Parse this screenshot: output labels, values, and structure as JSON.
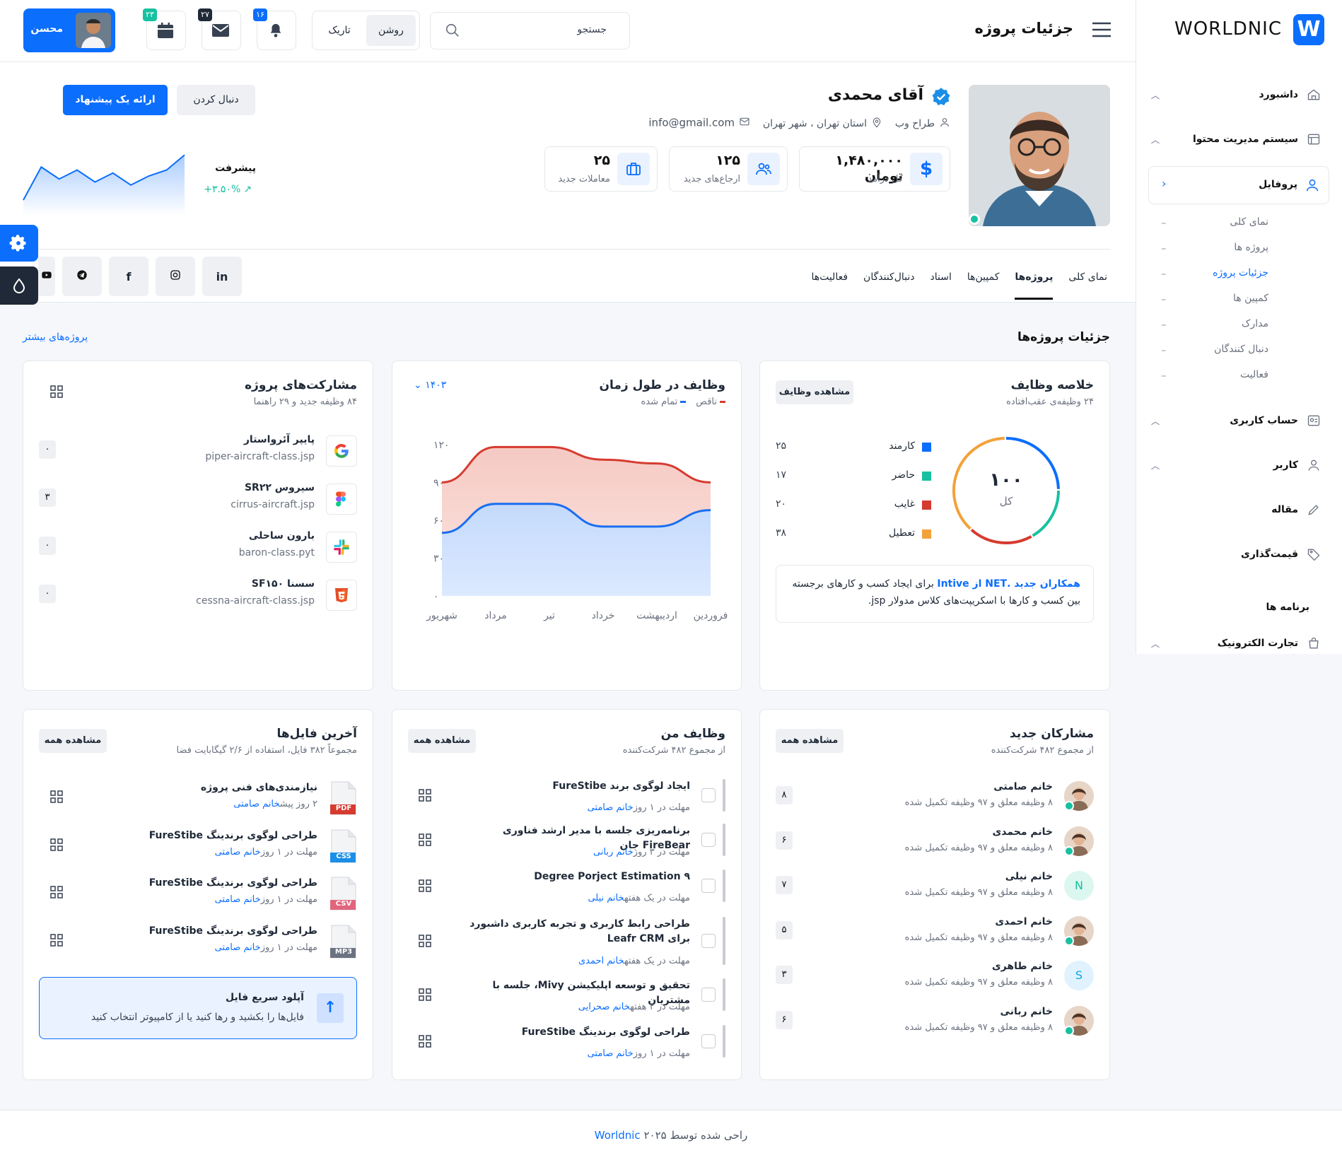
{
  "brand": {
    "name": "WORLDNIC",
    "logo_letter": "W"
  },
  "header": {
    "title": "جزئیات پروژه",
    "search_placeholder": "جستجو",
    "theme_light": "روشن",
    "theme_dark": "تاریک",
    "notif_count": "۱۶",
    "mail_count": "۲۷",
    "calendar_count": "۲۳",
    "user_name": "محسن"
  },
  "sidebar": {
    "items": [
      {
        "label": "داشبورد",
        "icon": "home-icon"
      },
      {
        "label": "سیستم مدیریت محتوا",
        "icon": "cms-icon"
      },
      {
        "label": "پروفایل",
        "icon": "user-icon"
      }
    ],
    "profile_sub": [
      "نمای کلی",
      "پروژه ها",
      "جزئیات پروژه",
      "کمپین ها",
      "مدارک",
      "دنبال کنندگان",
      "فعالیت"
    ],
    "items2": [
      {
        "label": "حساب کاربری",
        "icon": "account-icon"
      },
      {
        "label": "کاربر",
        "icon": "user2-icon"
      },
      {
        "label": "مقاله",
        "icon": "article-icon"
      },
      {
        "label": "قیمت‌گذاری",
        "icon": "tag-icon"
      }
    ],
    "section_label": "برنامه ها",
    "ecommerce": "تجارت الکترونیک"
  },
  "profile": {
    "name": "آقای محمدی",
    "role": "طراح وب",
    "location": "استان تهران ، شهر تهران",
    "email": "info@gmail.com",
    "follow_btn": "دنبال کردن",
    "offer_btn": "ارائه یک پیشنهاد",
    "stats": [
      {
        "value": "۱,۴۸۰,۰۰۰ تومان",
        "label": "کل درآمد"
      },
      {
        "value": "۱۲۵",
        "label": "ارجاع‌های جدید"
      },
      {
        "value": "۲۵",
        "label": "معاملات جدید"
      }
    ],
    "progress_label": "پیشرفت",
    "progress_value": "۳.۵۰%+",
    "sparkline": [
      20,
      75,
      55,
      70,
      50,
      65,
      45,
      60,
      70,
      95
    ]
  },
  "tabs": [
    "نمای کلی",
    "پروژه‌ها",
    "کمپین‌ها",
    "اسناد",
    "دنبال‌کنندگان",
    "فعالیت‌ها"
  ],
  "social": [
    "in",
    "instagram",
    "f",
    "telegram",
    "youtube"
  ],
  "section": {
    "title": "جزئیات پروژه‌ها",
    "more": "پروژه‌های بیشتر"
  },
  "tasks_summary": {
    "title": "خلاصه وظایف",
    "sub": "۲۴ وظیفه‌ی عقب‌افتاده",
    "button": "مشاهده وظایف",
    "total_value": "۱۰۰",
    "total_label": "کل",
    "legend": [
      {
        "label": "کارمند",
        "value": "۲۵",
        "color": "#0b6efd"
      },
      {
        "label": "حاضر",
        "value": "۱۷",
        "color": "#17c1a0"
      },
      {
        "label": "غایب",
        "value": "۲۰",
        "color": "#d63b2f"
      },
      {
        "label": "تعطیل",
        "value": "۳۸",
        "color": "#f2a23a"
      }
    ],
    "note_link": "همکاران جدید .NET از Intive",
    "note_text": "برای ایجاد کسب و کارهای برجسته بین کسب و کارها با اسکریپت‌های کلاس مدولار jsp."
  },
  "chart_data": {
    "type": "area",
    "title": "وظایف در طول زمان",
    "year": "۱۴۰۳",
    "categories": [
      "فروردین",
      "اردیبهشت",
      "خرداد",
      "تیر",
      "مرداد",
      "شهریور"
    ],
    "yticks": [
      "۰",
      "۳۰",
      "۶۰",
      "۹۰",
      "۱۲۰"
    ],
    "ylim": [
      0,
      130
    ],
    "series": [
      {
        "name": "ناقص",
        "color": "#d63b2f",
        "values": [
          90,
          118,
          118,
          108,
          105,
          90
        ]
      },
      {
        "name": "تمام شده",
        "color": "#1a6ef0",
        "values": [
          50,
          73,
          73,
          55,
          55,
          68
        ]
      }
    ]
  },
  "contributions": {
    "title": "مشارکت‌های پروژه",
    "sub": "۸۴ وظیفه جدید و ۲۹ راهنما",
    "items": [
      {
        "name": "پایپر آئرواستار",
        "file": "piper-aircraft-class.jsp",
        "count": "۰",
        "icon": "google-icon"
      },
      {
        "name": "سیروس SR۲۲",
        "file": "cirrus-aircraft.jsp",
        "count": "۳",
        "icon": "figma-icon"
      },
      {
        "name": "بارون ساحلی",
        "file": "baron-class.pyt",
        "count": "۰",
        "icon": "slack-icon"
      },
      {
        "name": "سسنا SF۱۵۰",
        "file": "cessna-aircraft-class.jsp",
        "count": "۰",
        "icon": "html5-icon"
      }
    ]
  },
  "new_participants": {
    "title": "مشارکان جدید",
    "sub": "از مجموع ۴۸۲ شرکت‌کننده",
    "button": "مشاهده همه",
    "items": [
      {
        "name": "خانم صامتی",
        "desc": "۸ وظیفه معلق و ۹۷ وظیفه تکمیل شده",
        "count": "۸",
        "avatar": "photo"
      },
      {
        "name": "خانم محمدی",
        "desc": "۸ وظیفه معلق و ۹۷ وظیفه تکمیل شده",
        "count": "۶",
        "avatar": "photo"
      },
      {
        "name": "خانم نیلی",
        "desc": "۸ وظیفه معلق و ۹۷ وظیفه تکمیل شده",
        "count": "۷",
        "avatar": "N"
      },
      {
        "name": "خانم احمدی",
        "desc": "۸ وظیفه معلق و ۹۷ وظیفه تکمیل شده",
        "count": "۵",
        "avatar": "photo"
      },
      {
        "name": "خانم طاهری",
        "desc": "۸ وظیفه معلق و ۹۷ وظیفه تکمیل شده",
        "count": "۳",
        "avatar": "S"
      },
      {
        "name": "خانم ربانی",
        "desc": "۸ وظیفه معلق و ۹۷ وظیفه تکمیل شده",
        "count": "۶",
        "avatar": "photo"
      }
    ]
  },
  "my_tasks": {
    "title": "وظایف من",
    "sub": "از مجموع ۴۸۲ شرکت‌کننده",
    "button": "مشاهده همه",
    "items": [
      {
        "title": "ایجاد لوگوی برند FureStibe",
        "due": "مهلت در ۱ روز",
        "person": "خانم صامتی"
      },
      {
        "title": "برنامه‌ریزی جلسه با مدیر ارشد فناوری FireBear جان",
        "due": "مهلت در ۳ روز",
        "person": "خانم ربانی"
      },
      {
        "title": "Degree Porject Estimation ۹",
        "due": "مهلت در یک هفته",
        "person": "خانم نیلی"
      },
      {
        "title": "طراحی رابط کاربری و تجربه کاربری داشبورد برای Leafr CRM",
        "due": "مهلت در یک هفته",
        "person": "خانم احمدی"
      },
      {
        "title": "تحقیق و توسعه اپلیکیشن Mivy، جلسه با مشتریان",
        "due": "مهلت در ۲ هفته",
        "person": "خانم صحرایی"
      },
      {
        "title": "طراحی لوگوی برندینگ FureStibe",
        "due": "مهلت در ۱ روز",
        "person": "خانم صامتی"
      }
    ]
  },
  "files": {
    "title": "آخرین فایل‌ها",
    "sub": "مجموعاً ۳۸۲ فایل، استفاده از ۲/۶ گیگابایت فضا",
    "button": "مشاهده همه",
    "items": [
      {
        "title": "نیازمندی‌های فنی پروژه",
        "meta": "۲ روز پیش",
        "person": "خانم صامتی",
        "type": "PDF",
        "color": "#d63b2f"
      },
      {
        "title": "طراحی لوگوی برندینگ FureStibe",
        "meta": "مهلت در ۱ روز",
        "person": "خانم صامتی",
        "type": "CSS",
        "color": "#1a8fe8"
      },
      {
        "title": "طراحی لوگوی برندینگ FureStibe",
        "meta": "مهلت در ۱ روز",
        "person": "خانم صامتی",
        "type": "CSV",
        "color": "#e0667d"
      },
      {
        "title": "طراحی لوگوی برندینگ FureStibe",
        "meta": "مهلت در ۱ روز",
        "person": "خانم صامتی",
        "type": "MP3",
        "color": "#6b7280"
      }
    ],
    "upload_title": "آپلود سریع فایل",
    "upload_text": "فایل‌ها را بکشید و رها کنید یا از کامپیوتر انتخاب کنید"
  },
  "footer": {
    "text": "راحی شده توسط ۲۰۲۵",
    "brand": "Worldnic"
  }
}
